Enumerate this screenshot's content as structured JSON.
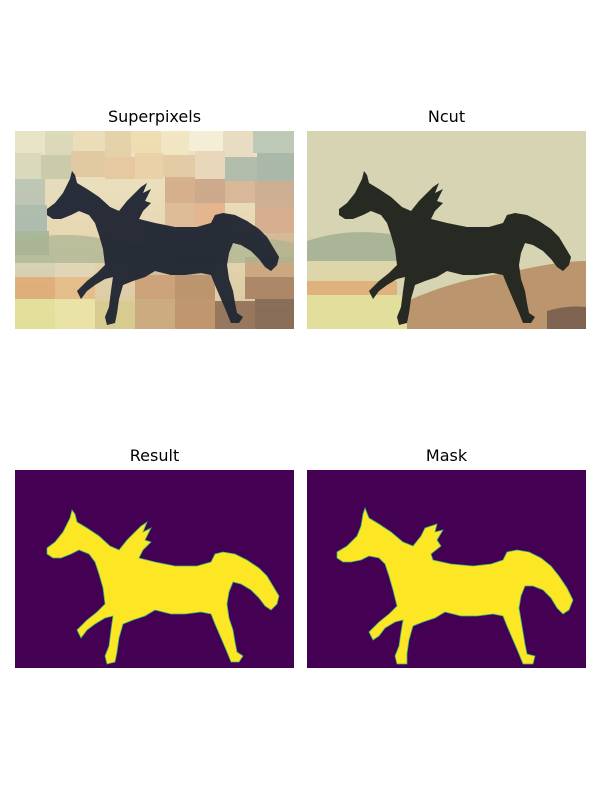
{
  "panels": {
    "superpixels": {
      "title": "Superpixels"
    },
    "ncut": {
      "title": "Ncut"
    },
    "result": {
      "title": "Result"
    },
    "mask": {
      "title": "Mask"
    }
  },
  "colors": {
    "mask_background": "#440154",
    "mask_foreground": "#fde725",
    "mask_edge": "#35b779",
    "ncut_sky": "#d6d4b2",
    "ncut_horse": "#262a22",
    "ncut_ground": "#bb956d",
    "superpixel_horse": "#28324a"
  }
}
